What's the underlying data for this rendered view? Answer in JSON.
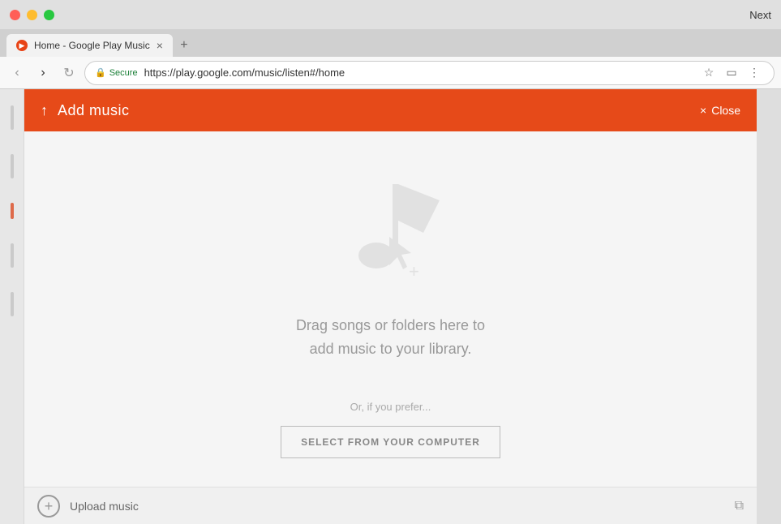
{
  "browser": {
    "title_bar": {
      "next_label": "Next"
    },
    "tab": {
      "favicon_letter": "▶",
      "title": "Home - Google Play Music",
      "close_symbol": "×"
    },
    "tab_new_symbol": "+",
    "nav": {
      "back_symbol": "‹",
      "forward_symbol": "›",
      "refresh_symbol": "↻"
    },
    "address_bar": {
      "secure_label": "Secure",
      "url": "https://play.google.com/music/listen#/home",
      "bookmark_symbol": "☆",
      "cast_symbol": "▭",
      "menu_symbol": "⋮"
    }
  },
  "modal": {
    "header": {
      "upload_icon": "↑",
      "title": "Add music",
      "close_icon": "×",
      "close_label": "Close"
    },
    "drop_zone": {
      "drag_text_line1": "Drag songs or folders here to",
      "drag_text_line2": "add music to your library.",
      "prefer_text": "Or, if you prefer...",
      "select_button_label": "SELECT FROM YOUR COMPUTER"
    }
  },
  "bottom_bar": {
    "add_symbol": "+",
    "upload_label": "Upload music",
    "external_link_symbol": "⧉"
  },
  "colors": {
    "header_bg": "#e64a19",
    "accent": "#e84315"
  }
}
